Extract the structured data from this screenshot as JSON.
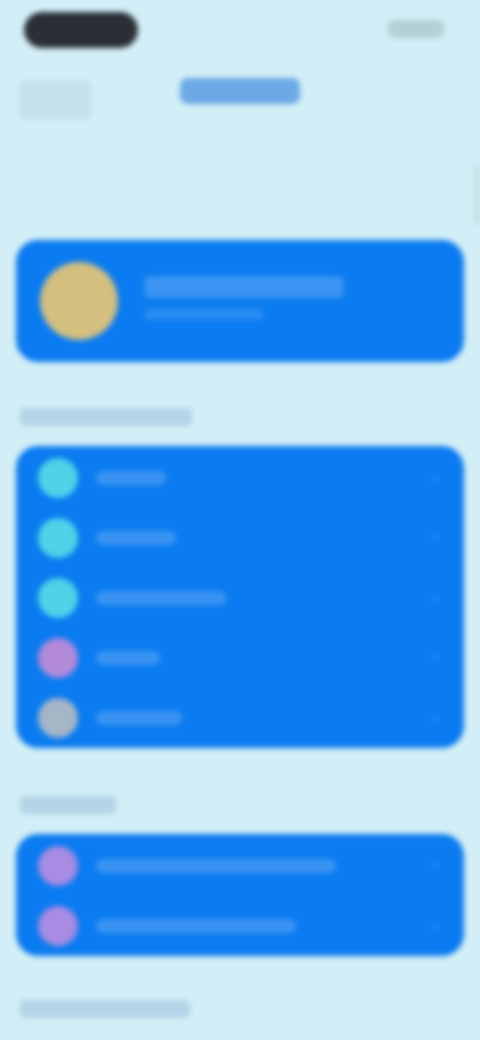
{
  "status_bar": {
    "time": "",
    "indicators": ""
  },
  "header": {
    "back_label": "",
    "title": "Settings"
  },
  "profile": {
    "name": "",
    "subtitle": ""
  },
  "sections": {
    "general_label": "",
    "network_label": "",
    "bottom_label": ""
  },
  "general_rows": [
    {
      "label": "",
      "icon": "cyan-circle-icon",
      "color": "#4fd3e8"
    },
    {
      "label": "",
      "icon": "cyan-circle-icon",
      "color": "#4fd3e8"
    },
    {
      "label": "",
      "icon": "cyan-circle-icon",
      "color": "#4fd3e8"
    },
    {
      "label": "",
      "icon": "purple-circle-icon",
      "color": "#b28ad8"
    },
    {
      "label": "",
      "icon": "gray-circle-icon",
      "color": "#a7b6c6"
    }
  ],
  "network_rows": [
    {
      "label": "",
      "icon": "purple-circle-icon",
      "color": "#a88be2"
    },
    {
      "label": "",
      "icon": "purple-circle-icon",
      "color": "#a88be2"
    }
  ],
  "colors": {
    "background": "#d2eef6",
    "card": "#0a7bf0",
    "avatar": "#d4bf7e"
  }
}
